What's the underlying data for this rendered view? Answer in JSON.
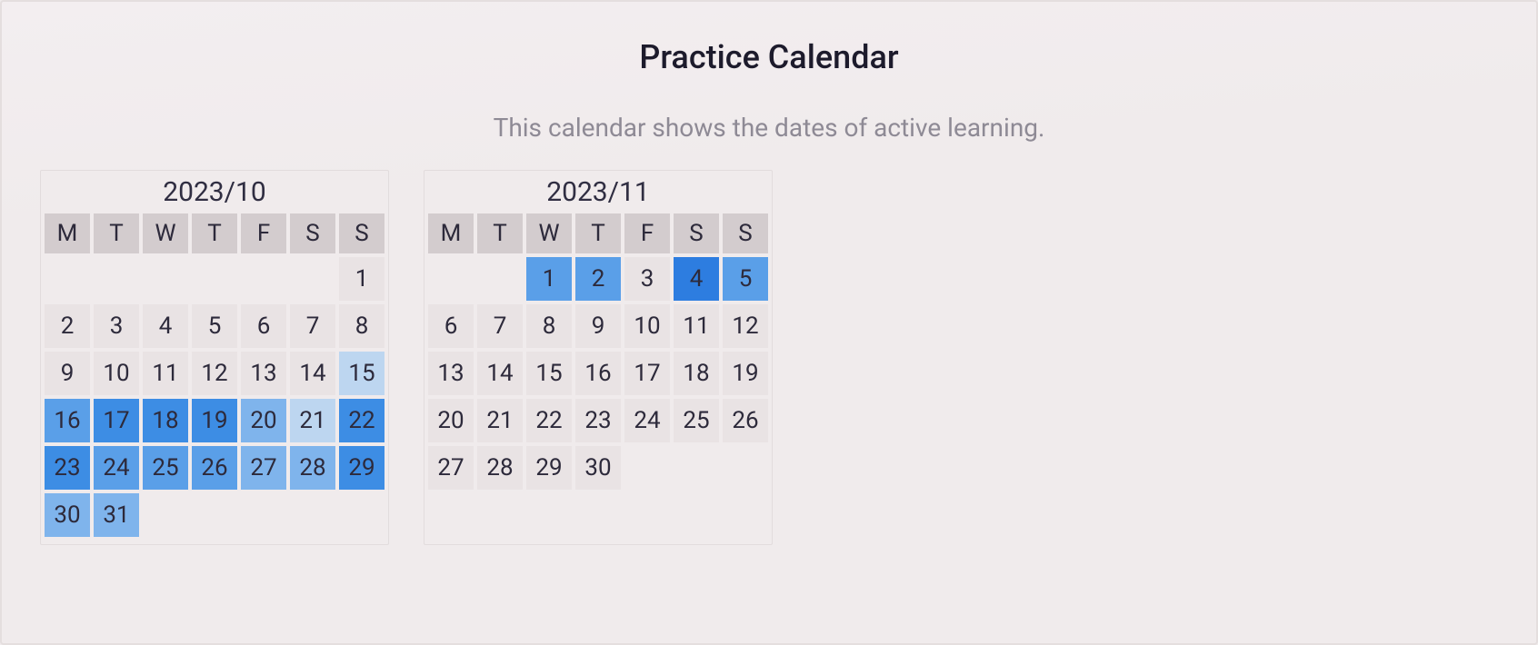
{
  "header": {
    "title": "Practice Calendar",
    "subtitle": "This calendar shows the dates of active learning."
  },
  "dayHeaders": [
    "M",
    "T",
    "W",
    "T",
    "F",
    "S",
    "S"
  ],
  "months": [
    {
      "label": "2023/10",
      "startOffset": 6,
      "days": [
        {
          "n": 1,
          "lvl": 0
        },
        {
          "n": 2,
          "lvl": 0
        },
        {
          "n": 3,
          "lvl": 0
        },
        {
          "n": 4,
          "lvl": 0
        },
        {
          "n": 5,
          "lvl": 0
        },
        {
          "n": 6,
          "lvl": 0
        },
        {
          "n": 7,
          "lvl": 0
        },
        {
          "n": 8,
          "lvl": 0
        },
        {
          "n": 9,
          "lvl": 0
        },
        {
          "n": 10,
          "lvl": 0
        },
        {
          "n": 11,
          "lvl": 0
        },
        {
          "n": 12,
          "lvl": 0
        },
        {
          "n": 13,
          "lvl": 0
        },
        {
          "n": 14,
          "lvl": 0
        },
        {
          "n": 15,
          "lvl": 1
        },
        {
          "n": 16,
          "lvl": 3
        },
        {
          "n": 17,
          "lvl": 4
        },
        {
          "n": 18,
          "lvl": 4
        },
        {
          "n": 19,
          "lvl": 4
        },
        {
          "n": 20,
          "lvl": 2
        },
        {
          "n": 21,
          "lvl": 1
        },
        {
          "n": 22,
          "lvl": 4
        },
        {
          "n": 23,
          "lvl": 4
        },
        {
          "n": 24,
          "lvl": 3
        },
        {
          "n": 25,
          "lvl": 3
        },
        {
          "n": 26,
          "lvl": 3
        },
        {
          "n": 27,
          "lvl": 2
        },
        {
          "n": 28,
          "lvl": 2
        },
        {
          "n": 29,
          "lvl": 4
        },
        {
          "n": 30,
          "lvl": 2
        },
        {
          "n": 31,
          "lvl": 2
        }
      ]
    },
    {
      "label": "2023/11",
      "startOffset": 2,
      "days": [
        {
          "n": 1,
          "lvl": 3
        },
        {
          "n": 2,
          "lvl": 3
        },
        {
          "n": 3,
          "lvl": 0
        },
        {
          "n": 4,
          "lvl": 5
        },
        {
          "n": 5,
          "lvl": 3
        },
        {
          "n": 6,
          "lvl": 0
        },
        {
          "n": 7,
          "lvl": 0
        },
        {
          "n": 8,
          "lvl": 0
        },
        {
          "n": 9,
          "lvl": 0
        },
        {
          "n": 10,
          "lvl": 0
        },
        {
          "n": 11,
          "lvl": 0
        },
        {
          "n": 12,
          "lvl": 0
        },
        {
          "n": 13,
          "lvl": 0
        },
        {
          "n": 14,
          "lvl": 0
        },
        {
          "n": 15,
          "lvl": 0
        },
        {
          "n": 16,
          "lvl": 0
        },
        {
          "n": 17,
          "lvl": 0
        },
        {
          "n": 18,
          "lvl": 0
        },
        {
          "n": 19,
          "lvl": 0
        },
        {
          "n": 20,
          "lvl": 0
        },
        {
          "n": 21,
          "lvl": 0
        },
        {
          "n": 22,
          "lvl": 0
        },
        {
          "n": 23,
          "lvl": 0
        },
        {
          "n": 24,
          "lvl": 0
        },
        {
          "n": 25,
          "lvl": 0
        },
        {
          "n": 26,
          "lvl": 0
        },
        {
          "n": 27,
          "lvl": 0
        },
        {
          "n": 28,
          "lvl": 0
        },
        {
          "n": 29,
          "lvl": 0
        },
        {
          "n": 30,
          "lvl": 0
        }
      ]
    }
  ]
}
